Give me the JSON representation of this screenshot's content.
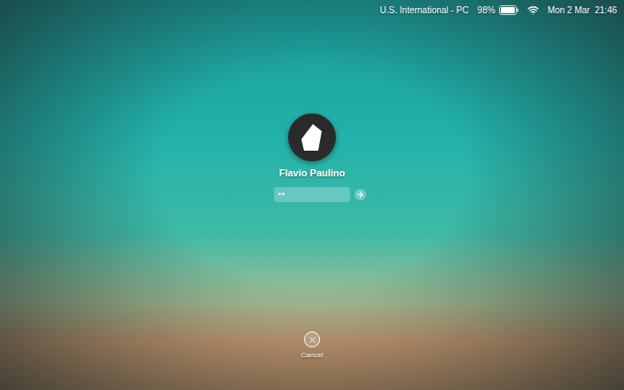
{
  "menu_bar": {
    "input_source": "U.S. International - PC",
    "battery": {
      "reading": "98%",
      "level": 0.98
    },
    "wifi": {
      "on": true
    },
    "clock": "Mon 2 Mar  21:46"
  },
  "login": {
    "user_name": "Flavio Paulino",
    "password": {
      "value": "••"
    }
  },
  "cancel": {
    "label": "Cancel"
  }
}
